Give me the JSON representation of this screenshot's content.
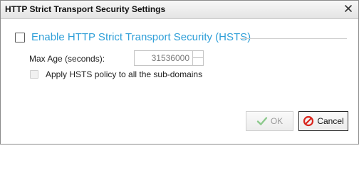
{
  "window": {
    "title": "HTTP Strict Transport Security Settings",
    "close_icon": "close-icon"
  },
  "hsts": {
    "enable_label": "Enable HTTP Strict Transport Security (HSTS)",
    "enabled": false,
    "max_age_label": "Max Age (seconds):",
    "max_age_value": "31536000",
    "subdomains_label": "Apply HSTS policy to all the sub-domains",
    "subdomains_checked": false
  },
  "buttons": {
    "ok_label": "OK",
    "ok_icon": "checkmark-icon",
    "cancel_label": "Cancel",
    "cancel_icon": "cancel-icon"
  },
  "colors": {
    "accent": "#2f9fd8",
    "ok_check": "#8cc98c",
    "cancel_red": "#d9251c"
  }
}
